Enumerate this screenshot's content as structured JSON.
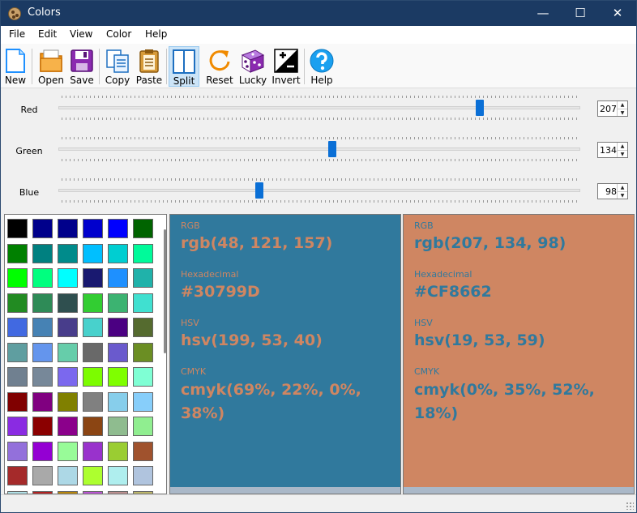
{
  "window": {
    "title": "Colors",
    "minimize": "—",
    "maximize": "☐",
    "close": "✕"
  },
  "menu": {
    "file": "File",
    "edit": "Edit",
    "view": "View",
    "color": "Color",
    "help": "Help"
  },
  "toolbar": {
    "new": "New",
    "open": "Open",
    "save": "Save",
    "copy": "Copy",
    "paste": "Paste",
    "split": "Split",
    "reset": "Reset",
    "lucky": "Lucky",
    "invert": "Invert",
    "help": "Help"
  },
  "sliders": {
    "red": {
      "label": "Red",
      "value": "207",
      "fraction": 0.812
    },
    "green": {
      "label": "Green",
      "value": "134",
      "fraction": 0.525
    },
    "blue": {
      "label": "Blue",
      "value": "98",
      "fraction": 0.384
    }
  },
  "palette": {
    "colors": [
      "#000000",
      "#00008b",
      "#00008b",
      "#0000cd",
      "#0000ff",
      "#006400",
      "#008000",
      "#008080",
      "#008b8b",
      "#00bfff",
      "#00ced1",
      "#00fa9a",
      "#00ff00",
      "#00ff7f",
      "#00ffff",
      "#191970",
      "#1e90ff",
      "#20b2aa",
      "#228b22",
      "#2e8b57",
      "#2f4f4f",
      "#32cd32",
      "#3cb371",
      "#40e0d0",
      "#4169e1",
      "#4682b4",
      "#483d8b",
      "#48d1cc",
      "#4b0082",
      "#556b2f",
      "#5f9ea0",
      "#6495ed",
      "#66cdaa",
      "#696969",
      "#6a5acd",
      "#6b8e23",
      "#708090",
      "#778899",
      "#7b68ee",
      "#7cfc00",
      "#7fff00",
      "#7fffd4",
      "#800000",
      "#800080",
      "#808000",
      "#808080",
      "#87ceeb",
      "#87cefa",
      "#8a2be2",
      "#8b0000",
      "#8b008b",
      "#8b4513",
      "#8fbc8f",
      "#90ee90",
      "#9370db",
      "#9400d3",
      "#98fb98",
      "#9932cc",
      "#9acd32",
      "#a0522d",
      "#a52a2a",
      "#a9a9a9",
      "#add8e6",
      "#adff2f",
      "#afeeee",
      "#b0c4de",
      "#b0e0e6",
      "#b22222",
      "#b8860b",
      "#ba55d3",
      "#bc8f8f",
      "#bdb76b"
    ]
  },
  "left_panel": {
    "bg": "#30799D",
    "fg": "#CF8662",
    "rgb_caption": "RGB",
    "rgb_value": "rgb(48, 121, 157)",
    "hex_caption": "Hexadecimal",
    "hex_value": "#30799D",
    "hsv_caption": "HSV",
    "hsv_value": "hsv(199, 53, 40)",
    "cmyk_caption": "CMYK",
    "cmyk_value": "cmyk(69%, 22%, 0%, 38%)"
  },
  "right_panel": {
    "bg": "#CF8662",
    "fg": "#30799D",
    "rgb_caption": "RGB",
    "rgb_value": "rgb(207, 134, 98)",
    "hex_caption": "Hexadecimal",
    "hex_value": "#CF8662",
    "hsv_caption": "HSV",
    "hsv_value": "hsv(19, 53, 59)",
    "cmyk_caption": "CMYK",
    "cmyk_value": "cmyk(0%, 35%, 52%, 18%)"
  }
}
